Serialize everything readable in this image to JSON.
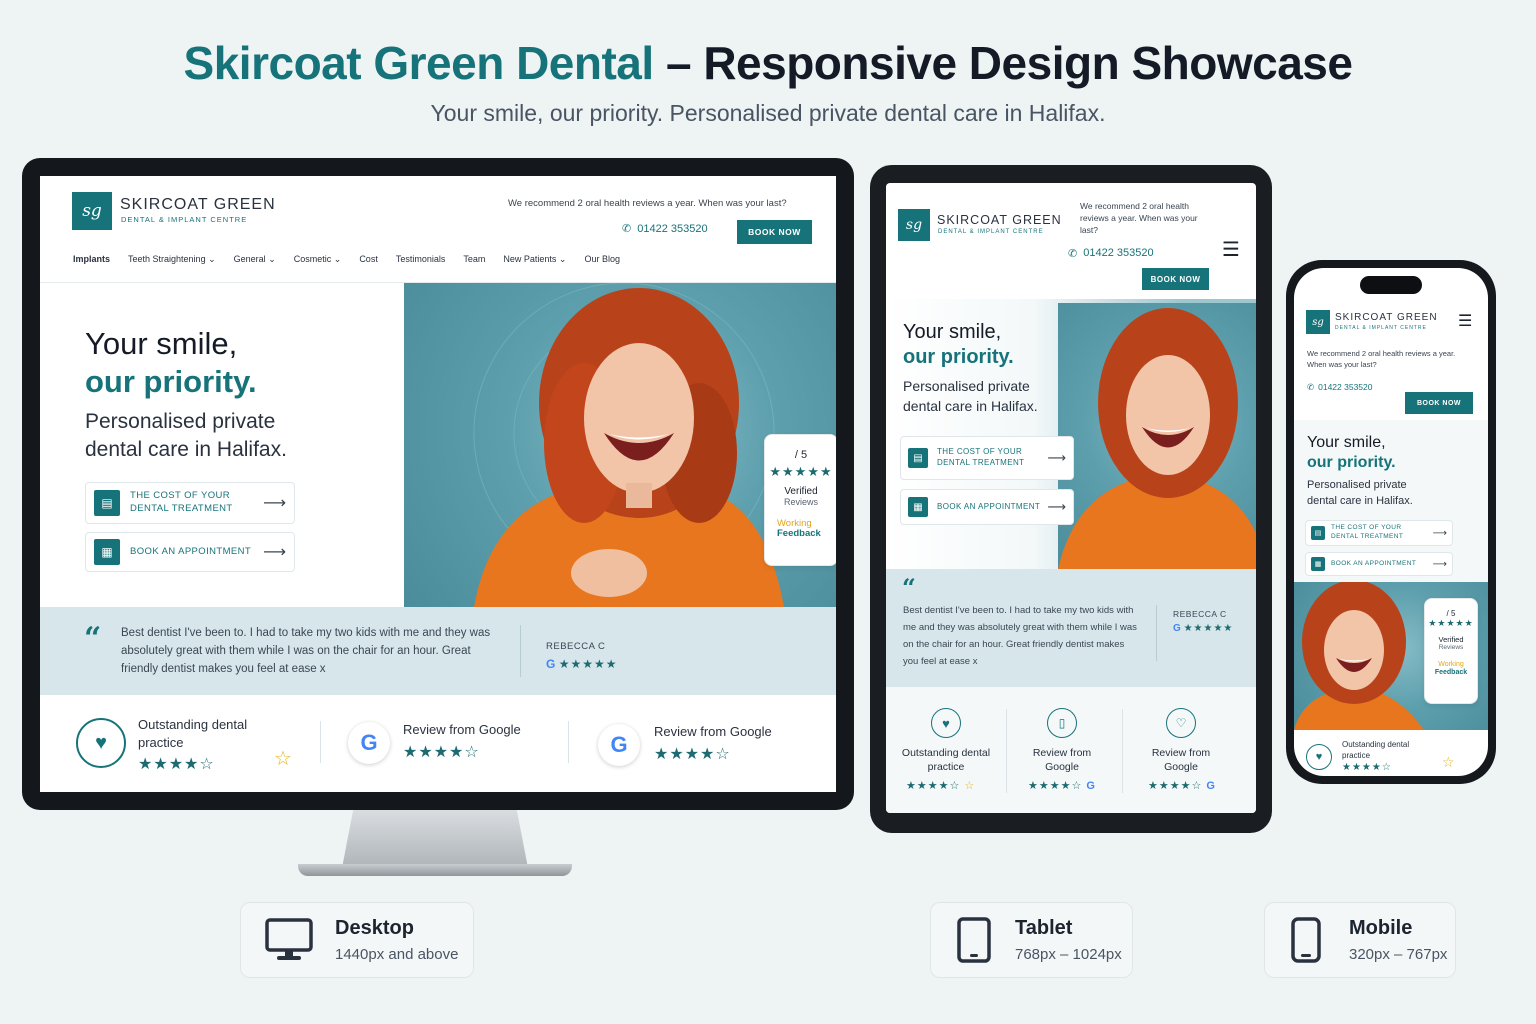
{
  "header": {
    "brand": "Skircoat Green Dental",
    "rest": " – Responsive Design Showcase",
    "subtitle": "Your smile, our priority. Personalised private dental care in Halifax."
  },
  "site": {
    "logo_mark": "sg",
    "logo_name": "SKIRCOAT GREEN",
    "logo_sub": "DENTAL & IMPLANT CENTRE",
    "recommend": "We recommend 2 oral health reviews a year. When was your last?",
    "phone": "01422 353520",
    "book_now": "BOOK NOW",
    "nav": [
      "Implants",
      "Teeth Straightening",
      "General",
      "Cosmetic",
      "Cost",
      "Testimonials",
      "Team",
      "New Patients",
      "Our Blog"
    ],
    "hero_line1": "Your smile,",
    "hero_line2": "our priority.",
    "hero_sub": "Personalised private dental care in Halifax.",
    "cta_cost": "THE COST OF YOUR DENTAL TREATMENT",
    "cta_book": "BOOK AN APPOINTMENT",
    "rating_score": "/ 5",
    "rating_stars": "★★★★★",
    "rating_verified": "Verified",
    "rating_reviews": "Reviews",
    "rating_brand1": "Working",
    "rating_brand2": "Feedback",
    "quote": "Best dentist I've been to. I had to take my two kids with me and they was absolutely great with them while I was on the chair for an hour. Great friendly dentist makes you feel at ease x",
    "quote_author": "REBECCA C",
    "badge1": "Outstanding dental practice",
    "badge_google": "Review from Google",
    "badge_google_tablet": "Review from Google",
    "stars": "★★★★★",
    "stars_half": "★★★★☆",
    "outline_star": "☆"
  },
  "devices": [
    {
      "name": "Desktop",
      "range": "1440px and above"
    },
    {
      "name": "Tablet",
      "range": "768px – 1024px"
    },
    {
      "name": "Mobile",
      "range": "320px – 767px"
    }
  ],
  "colors": {
    "accent": "#17737a",
    "band": "#d6e6ea",
    "orange": "#e8761e",
    "hair": "#c2451b"
  },
  "icons": [
    "monitor-icon",
    "tablet-icon",
    "phone-icon",
    "phone-call-icon",
    "menu-icon",
    "tooth-icon",
    "calendar-icon",
    "receipt-icon",
    "arrow-right-icon",
    "google-icon",
    "star-icon"
  ]
}
